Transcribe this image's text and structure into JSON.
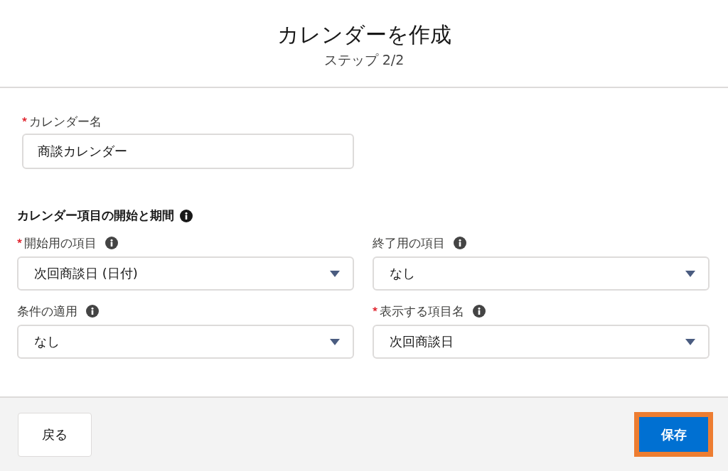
{
  "header": {
    "title": "カレンダーを作成",
    "subtitle": "ステップ 2/2"
  },
  "name_field": {
    "label": "カレンダー名",
    "required": true,
    "value": "商談カレンダー"
  },
  "section": {
    "heading": "カレンダー項目の開始と期間"
  },
  "fields": [
    {
      "label": "開始用の項目",
      "required": true,
      "value": "次回商談日 (日付)"
    },
    {
      "label": "終了用の項目",
      "required": false,
      "value": "なし"
    },
    {
      "label": "条件の適用",
      "required": false,
      "value": "なし"
    },
    {
      "label": "表示する項目名",
      "required": true,
      "value": "次回商談日"
    }
  ],
  "footer": {
    "back_button": "戻る",
    "save_button": "保存",
    "save_highlighted": true
  }
}
